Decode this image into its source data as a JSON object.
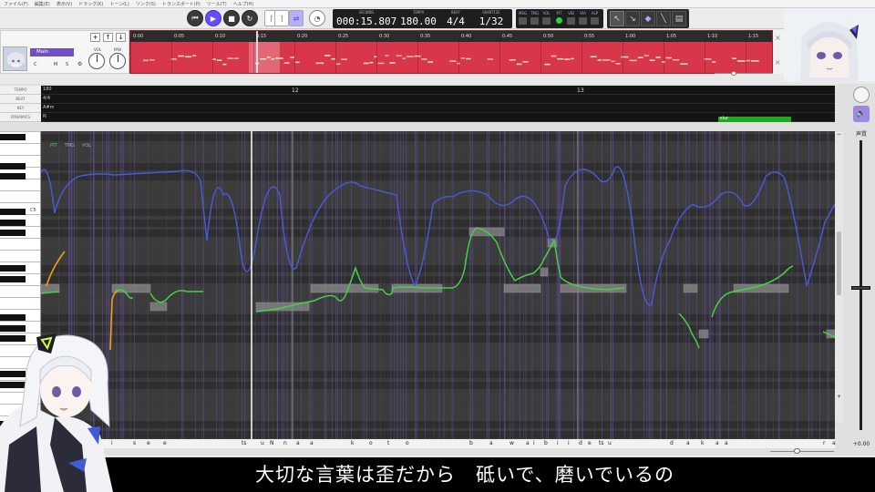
{
  "menu": [
    "ファイル(F)",
    "編集(E)",
    "表示(V)",
    "ドラッグ(K)",
    "トーン(L)",
    "リンク(S)",
    "トランスポート(P)",
    "ツール(T)",
    "ヘルプ(H)"
  ],
  "transport": {
    "seconds_label": "SECONDS",
    "seconds": "000:15.807",
    "tempo_label": "TEMPO",
    "tempo": "180.00",
    "beat_label": "BEAT",
    "beat": "4/4",
    "quantize_label": "QUANTIZE",
    "quantize": "1/32"
  },
  "modes": [
    "MSG",
    "TMG",
    "VOL",
    "PIT",
    "VIB",
    "VIA",
    "ALP"
  ],
  "active_mode": "PIT",
  "track": {
    "name": "Main",
    "vol_label": "VOL",
    "pan_label": "PAN",
    "buttons": [
      "C",
      "M",
      "S"
    ],
    "ruler": [
      "0:00",
      "0:05",
      "0:10",
      "0:15",
      "0:20",
      "0:25",
      "0:30",
      "0:35",
      "0:40",
      "0:45",
      "0:50",
      "0:55",
      "1:00",
      "1:05",
      "1:10",
      "1:15"
    ]
  },
  "global_rows": [
    {
      "label": "TEMPO",
      "value": "180"
    },
    {
      "label": "BEAT",
      "value": "4/4"
    },
    {
      "label": "KEY",
      "value": "A#m"
    },
    {
      "label": "DYNAMICS",
      "value": "N"
    }
  ],
  "measures": [
    "12",
    "13"
  ],
  "dynamics_tag": "slur",
  "pitch_tabs": [
    "PIT",
    "TMG",
    "VOL"
  ],
  "piano_c5": "C5",
  "lyrics": [
    "i",
    "s",
    "e",
    "e",
    "ts",
    "u",
    "N",
    "n",
    "a",
    "a",
    "k",
    "o",
    "t",
    "o",
    "b",
    "a",
    "w",
    "a",
    "i",
    "b",
    "i",
    "i",
    "d",
    "e",
    "ts",
    "u",
    "d",
    "a",
    "k",
    "a",
    "a",
    "r",
    "a"
  ],
  "note_segments": [
    "i",
    "i",
    "e",
    "ts",
    "n",
    "a",
    "ko",
    "to",
    "ba",
    "wa",
    "bi",
    "de",
    "ts",
    "u",
    "da",
    "ka",
    "ra"
  ],
  "right_panel": {
    "label": "声質",
    "value": "+0.00"
  },
  "subtitle": "大切な言葉は歪だから　砥いで、磨いでいるの",
  "colors": {
    "accent": "#6a4cff",
    "track": "#d8364a",
    "pitch": "#46d046",
    "vibrato": "#f2a11a",
    "curve": "#4a5ad8"
  }
}
